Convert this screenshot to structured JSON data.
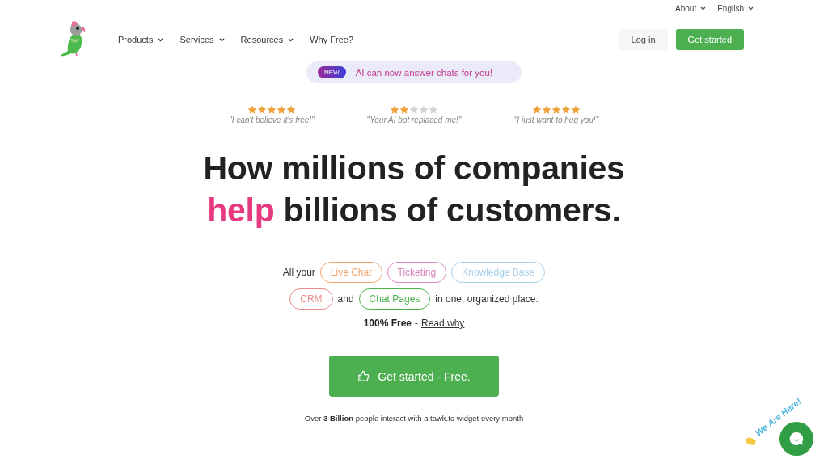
{
  "utility_menu": [
    {
      "label": "About"
    },
    {
      "label": "English"
    }
  ],
  "nav": {
    "items": [
      {
        "label": "Products",
        "dropdown": true
      },
      {
        "label": "Services",
        "dropdown": true
      },
      {
        "label": "Resources",
        "dropdown": true
      },
      {
        "label": "Why Free?",
        "dropdown": false
      }
    ],
    "login": "Log in",
    "cta": "Get started"
  },
  "announcement": {
    "badge": "NEW",
    "text": "AI can now answer chats for you!"
  },
  "reviews": [
    {
      "stars": 5,
      "quote": "\"I can't believe it's free!\""
    },
    {
      "stars": 2,
      "quote": "\"Your AI bot replaced me!\""
    },
    {
      "stars": 5,
      "quote": "\"I just want to hug you!\""
    }
  ],
  "headline": [
    {
      "parts": [
        {
          "text": "How millions of companies",
          "accent": false
        }
      ]
    },
    {
      "parts": [
        {
          "text": "help",
          "accent": true
        },
        {
          "text": " billions of customers.",
          "accent": false
        }
      ]
    }
  ],
  "features": [
    [
      {
        "kind": "text",
        "text": "All your"
      },
      {
        "kind": "tag",
        "text": "Live Chat",
        "color": "#f0a46c"
      },
      {
        "kind": "tag",
        "text": "Ticketing",
        "color": "#d884bd"
      },
      {
        "kind": "tag",
        "text": "Knowledge Base",
        "color": "#a8d0ea"
      }
    ],
    [
      {
        "kind": "tag",
        "text": "CRM",
        "color": "#e98b8b"
      },
      {
        "kind": "text",
        "text": "and"
      },
      {
        "kind": "tag",
        "text": "Chat Pages",
        "color": "#4cb34c"
      },
      {
        "kind": "text",
        "text": "in one, organized place."
      }
    ]
  ],
  "free_note": {
    "text": "100% Free",
    "separator": "-",
    "link": "Read why"
  },
  "main_cta": "Get started - Free.",
  "footer_note": "Over **3 Billion** people interact with a tawk.to widget every month",
  "chat_widget": {
    "label": "We Are Here!"
  }
}
